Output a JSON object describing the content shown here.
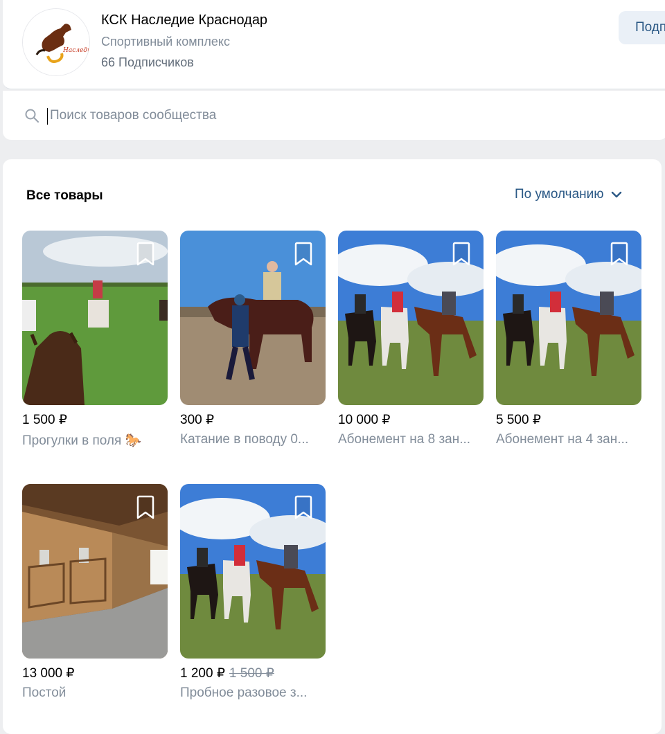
{
  "community": {
    "name": "КСК Наследие Краснодар",
    "type": "Спортивный комплекс",
    "subscribers": "66 Подписчиков",
    "logo_text": "Наследие",
    "subscribe_label": "Подписаться"
  },
  "search": {
    "placeholder": "Поиск товаров сообщества",
    "value": ""
  },
  "products_section": {
    "title": "Все товары",
    "sort_label": "По умолчанию"
  },
  "products": [
    {
      "price": "1 500 ₽",
      "old_price": "",
      "title": "Прогулки в поля 🐎"
    },
    {
      "price": "300 ₽",
      "old_price": "",
      "title": "Катание в поводу 0..."
    },
    {
      "price": "10 000 ₽",
      "old_price": "",
      "title": "Абонемент на 8 зан..."
    },
    {
      "price": "5 500 ₽",
      "old_price": "",
      "title": "Абонемент на 4 зан..."
    },
    {
      "price": "13 000 ₽",
      "old_price": "",
      "title": "Постой"
    },
    {
      "price": "1 200 ₽",
      "old_price": "1 500 ₽",
      "title": "Пробное разовое з..."
    }
  ],
  "colors": {
    "accent": "#2a5885",
    "secondary_text": "#818c99",
    "background": "#edeef0"
  }
}
